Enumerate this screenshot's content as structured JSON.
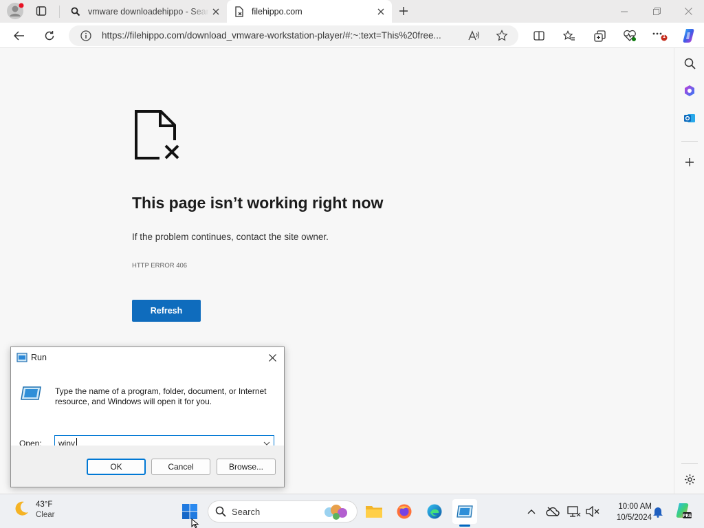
{
  "browser": {
    "tabs": [
      {
        "title": "vmware downloadehippo - Search",
        "active": false
      },
      {
        "title": "filehippo.com",
        "active": true
      }
    ],
    "address_bar": {
      "url": "https://filehippo.com/download_vmware-workstation-player/#:~:text=This%20free..."
    },
    "notification_badge": "1"
  },
  "error_page": {
    "title": "This page isn’t working right now",
    "description": "If the problem continues, contact the site owner.",
    "error_code": "HTTP ERROR 406",
    "refresh_label": "Refresh"
  },
  "run_dialog": {
    "title": "Run",
    "description": "Type the name of a program, folder, document, or Internet resource, and Windows will open it for you.",
    "open_label": "Open:",
    "input_value": "winv",
    "buttons": {
      "ok": "OK",
      "cancel": "Cancel",
      "browse": "Browse..."
    }
  },
  "taskbar": {
    "weather": {
      "temperature": "43°F",
      "condition": "Clear"
    },
    "search_placeholder": "Search",
    "clock": {
      "time": "10:00 AM",
      "date": "10/5/2024"
    }
  },
  "colors": {
    "accent": "#0f6cbd",
    "dialog_focus": "#0078d4",
    "taskbar_bg": "#eef0f3"
  }
}
